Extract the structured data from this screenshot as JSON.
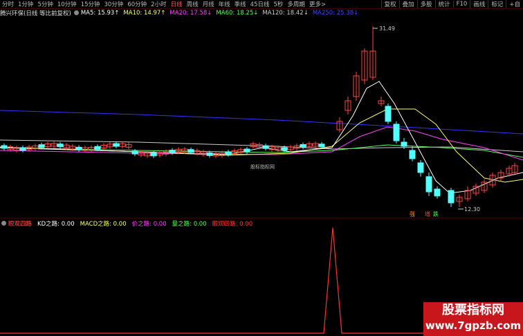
{
  "toolbar": {
    "timeframes": [
      "分时",
      "1分钟",
      "5分钟",
      "10分钟",
      "15分钟",
      "30分钟",
      "60分钟",
      "2小时",
      "日线",
      "周线",
      "月线",
      "年线",
      "季线",
      "45日线",
      "5秒",
      "多周期",
      "更多>"
    ],
    "active_index": 8,
    "right_buttons": [
      "复权",
      "叠加",
      "多股",
      "统计",
      "F10",
      "画线",
      "标记",
      "+自"
    ]
  },
  "ma_bar": {
    "title": "腾兴环保(日线 等比前复权)",
    "items": [
      {
        "text": "MA5: 15.93↑",
        "color": "#ffffff"
      },
      {
        "text": "MA10: 14.97↑",
        "color": "#ffff66"
      },
      {
        "text": "MA20: 17.58↓",
        "color": "#ff44ff"
      },
      {
        "text": "MA60: 18.25↓",
        "color": "#55ff55"
      },
      {
        "text": "MA120: 18.42↓",
        "color": "#cccccc"
      },
      {
        "text": "MA250: 25.38↓",
        "color": "#4444ff"
      }
    ]
  },
  "chart_labels": {
    "high": "31.49",
    "low": "12.30",
    "center_text": "股标指标网",
    "signals": [
      {
        "text": "强",
        "color": "#ff8c00"
      },
      {
        "text": "增",
        "color": "#ff4444"
      },
      {
        "text": "跌",
        "color": "#55ff55"
      }
    ]
  },
  "indicator_bar": {
    "name": "眼观四路",
    "items": [
      {
        "text": "KD之路: 0.00",
        "color": "#ffffff"
      },
      {
        "text": "MACD之路: 0.00",
        "color": "#ffff66"
      },
      {
        "text": "价之路: 0.00",
        "color": "#ff44ff"
      },
      {
        "text": "量之路: 0.00",
        "color": "#55ff55"
      },
      {
        "text": "眼观四路: 0.00",
        "color": "#ff3333"
      }
    ]
  },
  "watermark": {
    "line1": "股票指标网",
    "line2": "www.7gpzb.com"
  },
  "colors": {
    "up": "#ff4444",
    "down": "#54ffff",
    "ma5": "#ffffff",
    "ma10": "#ffff66",
    "ma20": "#ff44ff",
    "ma60": "#55ff55",
    "ma120": "#cccccc",
    "ma250": "#3333ff"
  }
}
